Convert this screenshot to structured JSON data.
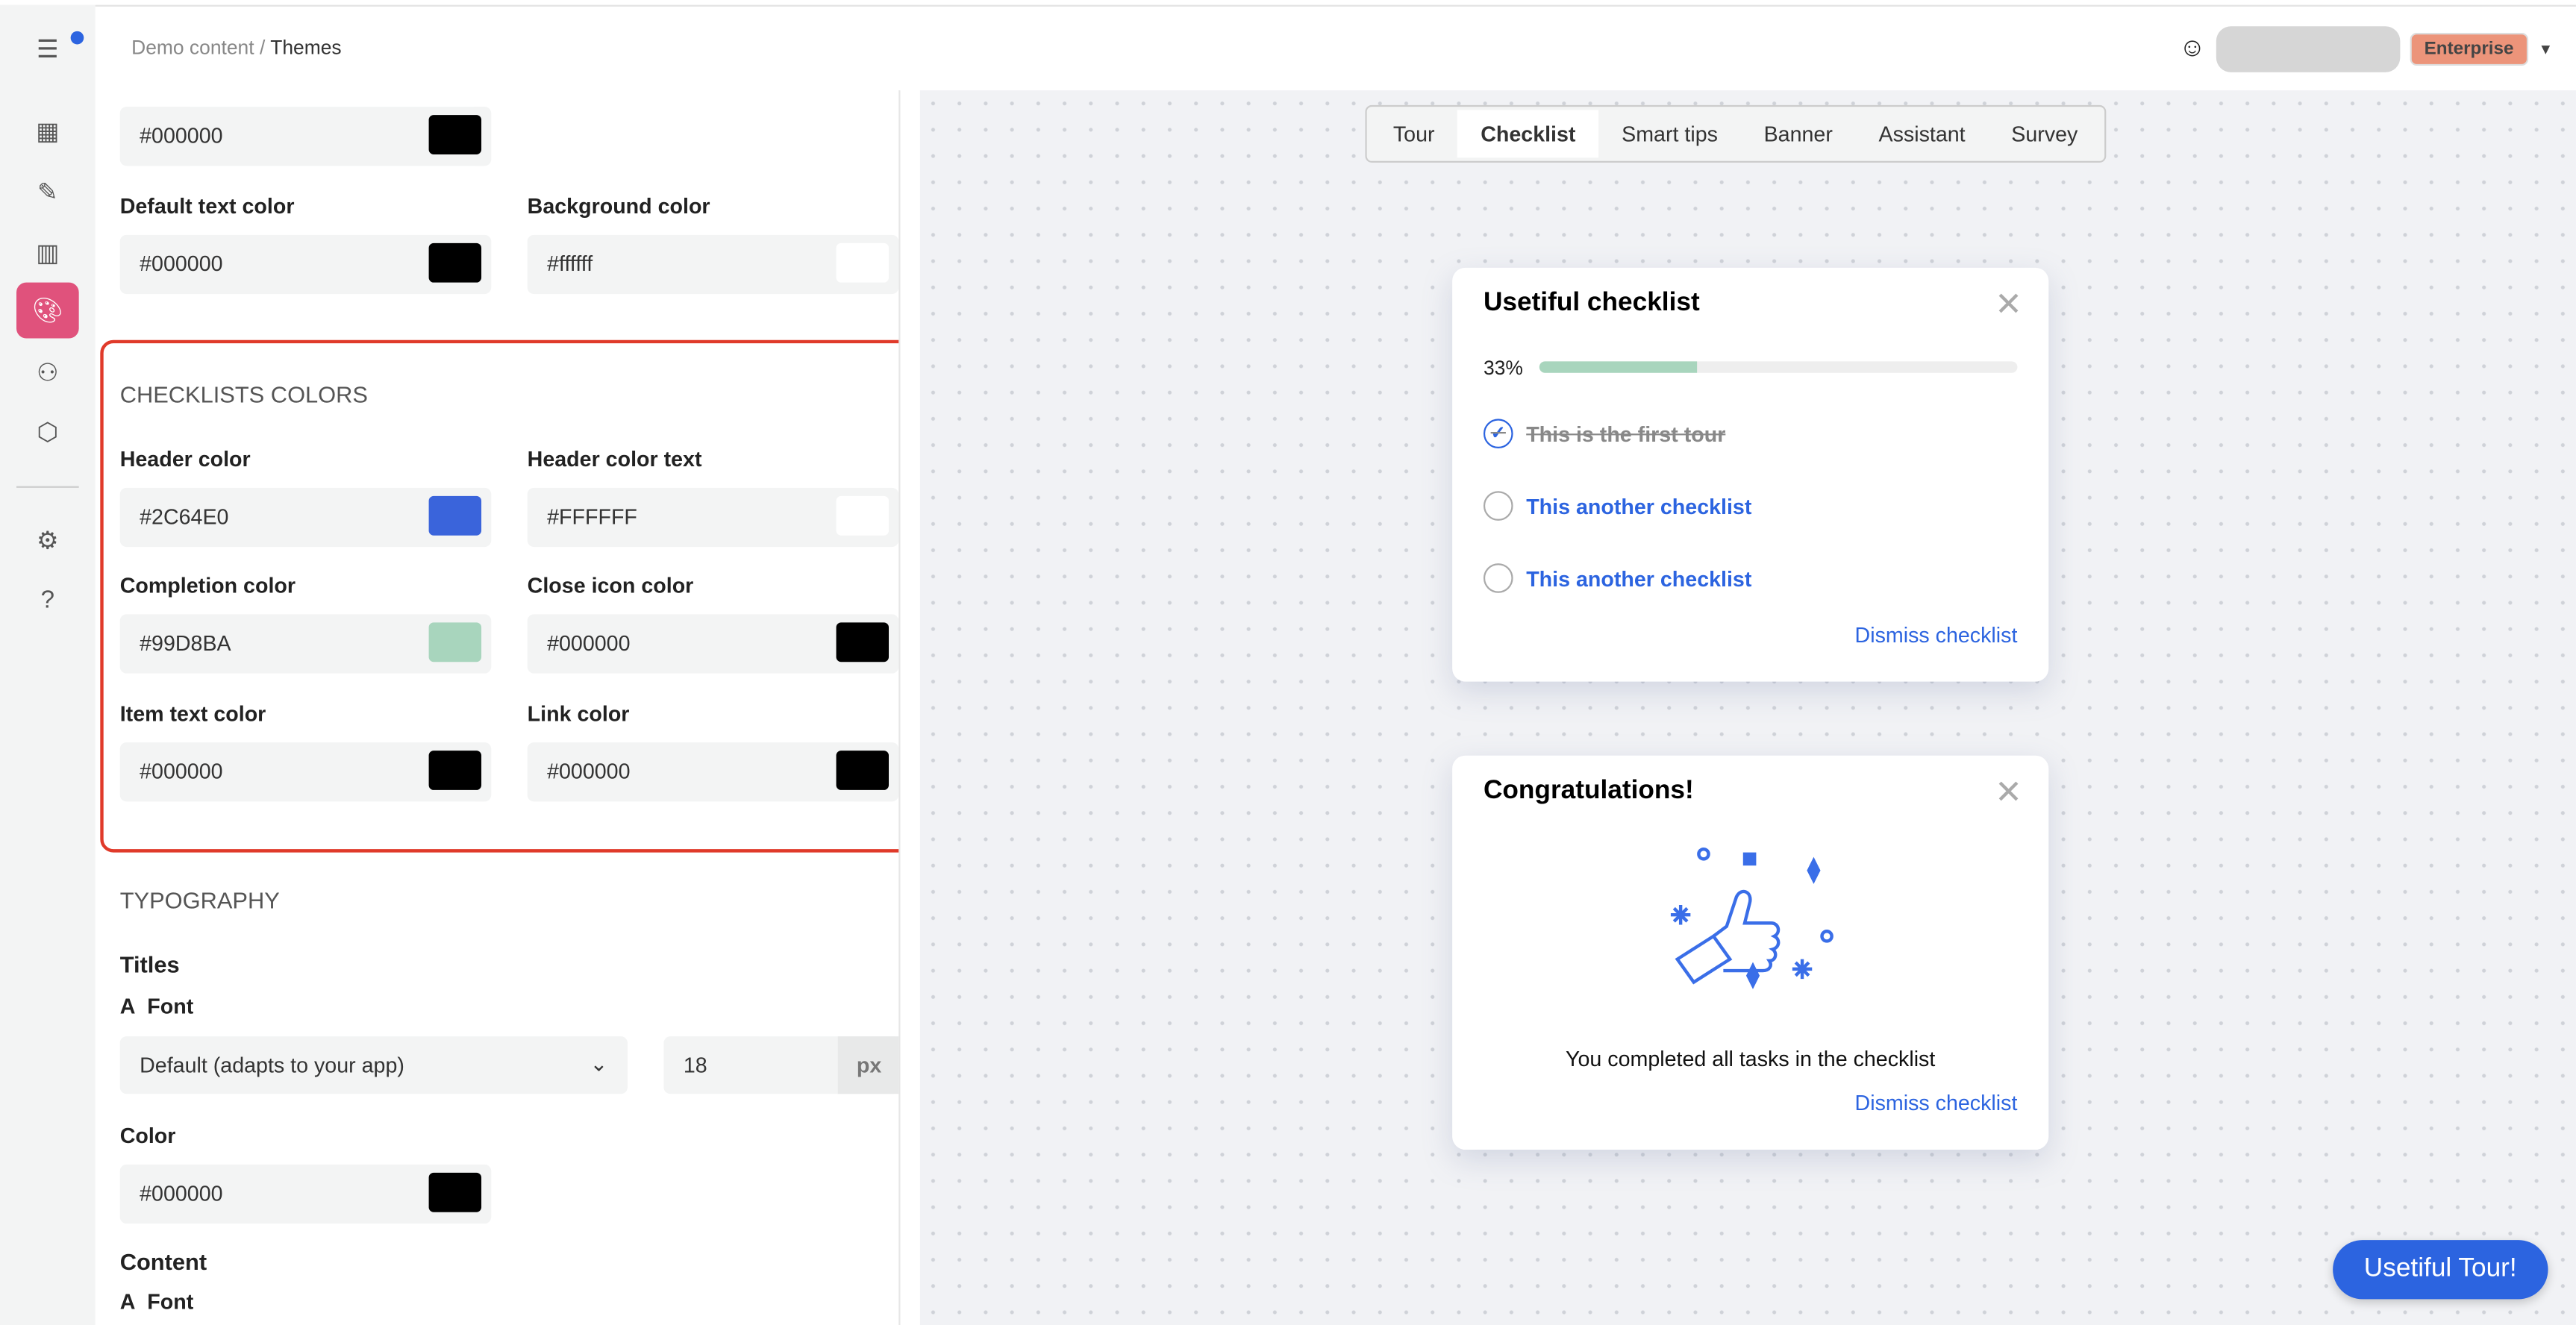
{
  "breadcrumb": {
    "parent": "Demo content",
    "separator": "/",
    "current": "Themes"
  },
  "user": {
    "plan": "Enterprise"
  },
  "sidebar": {
    "icons": [
      "menu-icon",
      "dashboard-icon",
      "content-icon",
      "analytics-icon",
      "themes-icon",
      "segments-icon",
      "integrations-icon",
      "settings-icon",
      "help-icon"
    ],
    "active": "themes-icon"
  },
  "colors": {
    "accent": "#2c64e0",
    "active_nav": "#e0527c",
    "plan_badge": "#ec947a",
    "highlight": "#e03a2a"
  },
  "settings": {
    "top_field": "#000000",
    "default_text_color": {
      "label": "Default text color",
      "value": "#000000"
    },
    "background_color": {
      "label": "Background color",
      "value": "#ffffff"
    },
    "checklists": {
      "title": "CHECKLISTS COLORS",
      "header_color": {
        "label": "Header color",
        "value": "#2C64E0"
      },
      "header_color_text": {
        "label": "Header color text",
        "value": "#FFFFFF"
      },
      "completion_color": {
        "label": "Completion color",
        "value": "#99D8BA"
      },
      "close_icon_color": {
        "label": "Close icon color",
        "value": "#000000"
      },
      "item_text_color": {
        "label": "Item text color",
        "value": "#000000"
      },
      "link_color": {
        "label": "Link color",
        "value": "#000000"
      }
    },
    "typography": {
      "title": "TYPOGRAPHY",
      "titles": "Titles",
      "font_label": "Font",
      "font_value": "Default (adapts to your app)",
      "size": "18",
      "unit": "px",
      "color_label": "Color",
      "color_value": "#000000",
      "content": "Content",
      "content_font_label": "Font"
    }
  },
  "preview": {
    "tabs": [
      "Tour",
      "Checklist",
      "Smart tips",
      "Banner",
      "Assistant",
      "Survey"
    ],
    "active_tab": "Checklist",
    "checklist": {
      "title": "Usetiful checklist",
      "progress_label": "33%",
      "progress": 33,
      "items": [
        {
          "text": "This is the first tour",
          "done": true
        },
        {
          "text": "This another checklist",
          "done": false
        },
        {
          "text": "This another checklist",
          "done": false
        }
      ],
      "dismiss": "Dismiss checklist"
    },
    "congrats": {
      "title": "Congratulations!",
      "message": "You completed all tasks in the checklist",
      "dismiss": "Dismiss checklist"
    },
    "launcher": "Usetiful Tour!"
  }
}
